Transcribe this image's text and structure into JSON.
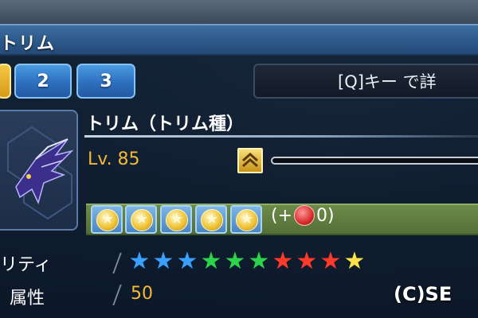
{
  "window": {
    "title": "トリム"
  },
  "tabs": [
    {
      "label": "",
      "active": true
    },
    {
      "label": "2",
      "active": false
    },
    {
      "label": "3",
      "active": false
    }
  ],
  "hint": {
    "text": "[Q]キー で詳"
  },
  "pet": {
    "name": "トリム（トリム種）",
    "level": "Lv. 85",
    "level_icon": "rank-up-chevron-icon",
    "xp_progress": 0.0,
    "medal_count": 5,
    "medal_icon": "star-medal-icon",
    "bonus_text_prefix": "(+",
    "bonus_icon": "red-gem-icon",
    "bonus_text_suffix": "0)"
  },
  "stats": {
    "rarity_label": "リティ",
    "rarity_stars": [
      "#3aa0ff",
      "#3aa0ff",
      "#3aa0ff",
      "#2bd44a",
      "#2bd44a",
      "#2bd44a",
      "#ff3a2a",
      "#ff3a2a",
      "#ff3a2a",
      "#ffe14a"
    ],
    "attribute_label": "属性",
    "attribute_value": "50"
  },
  "footer": {
    "copyright": "(C)SE"
  },
  "colors": {
    "accent_gold": "#f4b938",
    "tab_blue": "#2d6fbf",
    "title_blue": "#2d5a8c"
  }
}
